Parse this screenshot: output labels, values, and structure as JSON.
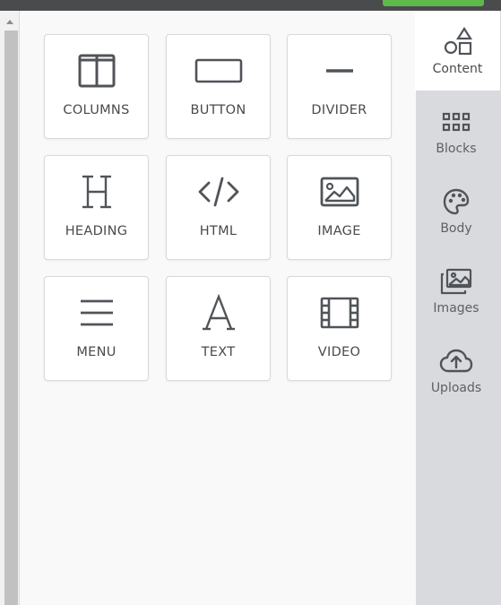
{
  "content_tools": [
    {
      "label": "COLUMNS",
      "icon": "columns-icon"
    },
    {
      "label": "BUTTON",
      "icon": "button-icon"
    },
    {
      "label": "DIVIDER",
      "icon": "divider-icon"
    },
    {
      "label": "HEADING",
      "icon": "heading-icon"
    },
    {
      "label": "HTML",
      "icon": "code-icon"
    },
    {
      "label": "IMAGE",
      "icon": "image-icon"
    },
    {
      "label": "MENU",
      "icon": "menu-icon"
    },
    {
      "label": "TEXT",
      "icon": "text-icon"
    },
    {
      "label": "VIDEO",
      "icon": "film-icon"
    }
  ],
  "sidebar": {
    "items": [
      {
        "label": "Content",
        "icon": "shapes-icon",
        "active": true
      },
      {
        "label": "Blocks",
        "icon": "grid-icon",
        "active": false
      },
      {
        "label": "Body",
        "icon": "palette-icon",
        "active": false
      },
      {
        "label": "Images",
        "icon": "images-icon",
        "active": false
      },
      {
        "label": "Uploads",
        "icon": "cloud-upload-icon",
        "active": false
      }
    ]
  },
  "colors": {
    "top_bar": "#4a4b4d",
    "action_button": "#5fb84a",
    "sidebar_bg": "#d8dadd",
    "icon": "#505459"
  }
}
